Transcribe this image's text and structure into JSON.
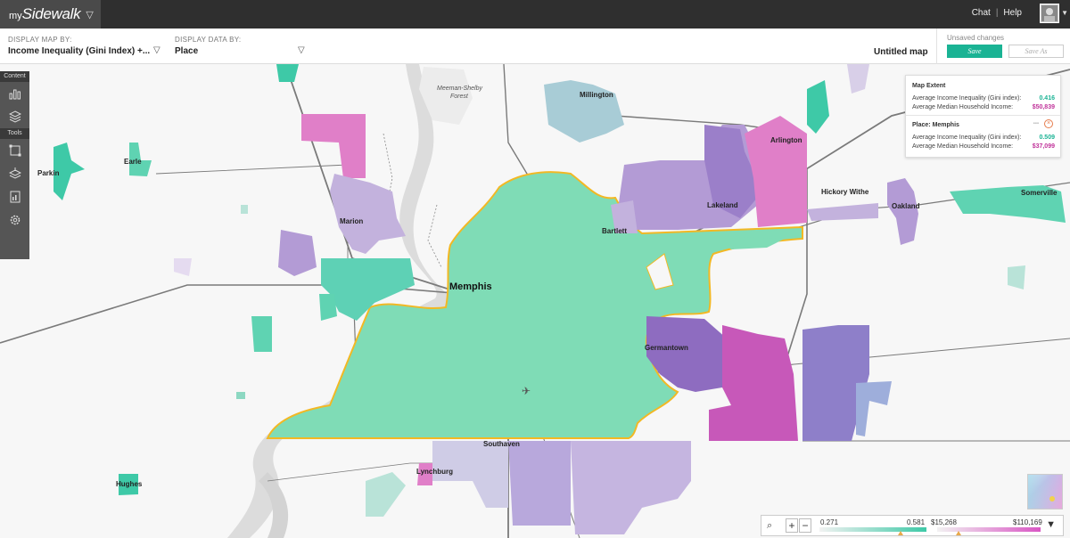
{
  "app": {
    "logo_small": "my",
    "logo_big": "Sidewalk",
    "nav_chat": "Chat",
    "nav_sep": "|",
    "nav_help": "Help"
  },
  "controls": {
    "display_map_label": "DISPLAY MAP BY:",
    "display_map_value": "Income Inequality (Gini Index) +...",
    "display_data_label": "DISPLAY DATA BY:",
    "display_data_value": "Place",
    "map_title": "Untitled map",
    "unsaved": "Unsaved changes",
    "save": "Save",
    "save_as": "Save As"
  },
  "toolbar": {
    "content_label": "Content",
    "tools_label": "Tools"
  },
  "info_panel": {
    "extent_title": "Map Extent",
    "extent_gini_label": "Average Income Inequality (Gini index):",
    "extent_gini_value": "0.416",
    "extent_income_label": "Average Median Household Income:",
    "extent_income_value": "$50,839",
    "place_title": "Place: Memphis",
    "place_gini_label": "Average Income Inequality (Gini index):",
    "place_gini_value": "0.509",
    "place_income_label": "Average Median Household Income:",
    "place_income_value": "$37,099"
  },
  "legend": {
    "gini_min": "0.271",
    "gini_max": "0.581",
    "income_min": "$15,268",
    "income_max": "$110,169"
  },
  "places": {
    "millington": "Millington",
    "meeman": "Meeman-Shelby",
    "forest": "Forest",
    "arlington": "Arlington",
    "parkin": "Parkin",
    "earle": "Earle",
    "marion": "Marion",
    "lakeland": "Lakeland",
    "bartlett": "Bartlett",
    "hickory": "Hickory Withe",
    "oakland": "Oakland",
    "somerville": "Somerville",
    "memphis": "Memphis",
    "germantown": "Germantown",
    "southaven": "Southaven",
    "lynchburg": "Lynchburg",
    "hughes": "Hughes"
  },
  "colors": {
    "teal": "#3ec9a7",
    "memphis_fill": "#7fdcb6",
    "purple": "#8e6cc0",
    "magenta": "#d956c4",
    "lavender": "#b7a6d9",
    "highlight": "#f2b824",
    "accent": "#1ab394"
  }
}
